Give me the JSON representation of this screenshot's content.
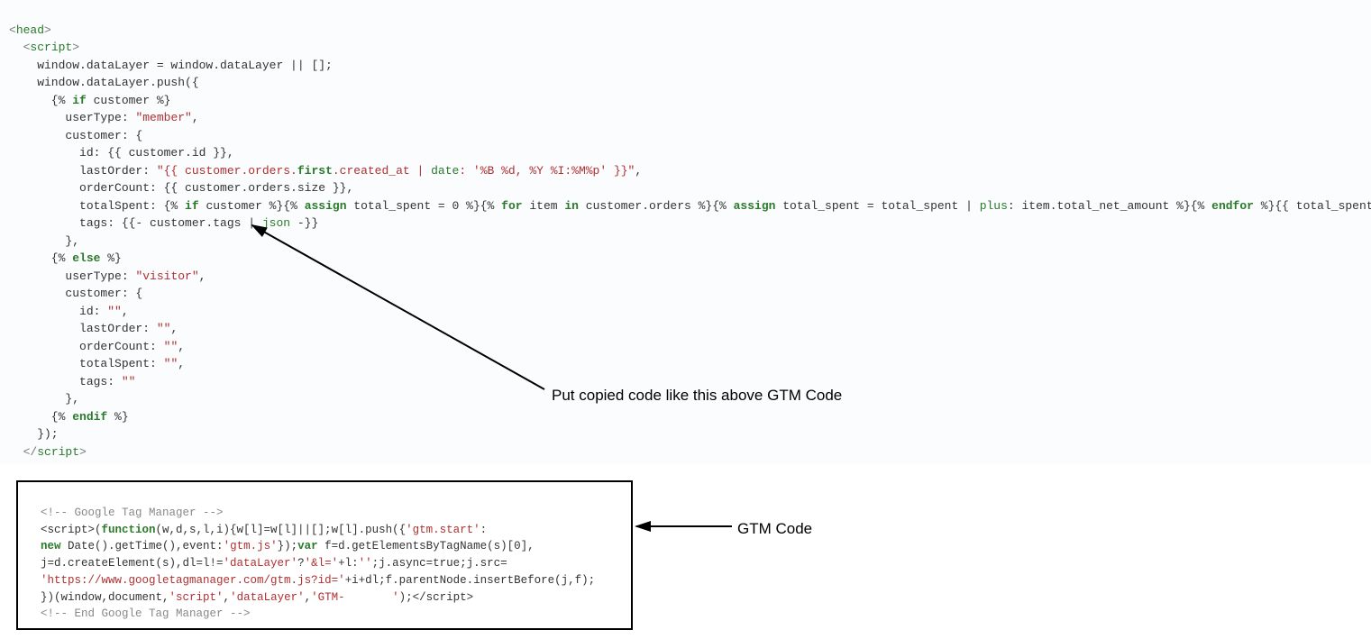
{
  "code": {
    "l1": "<head>",
    "l2": "  <script>",
    "l3a": "    window.dataLayer = window.dataLayer || [];",
    "l4a": "    window.dataLayer.push({",
    "l5a": "      {% ",
    "l5b": "if",
    "l5c": " customer %}",
    "l6a": "        userType: ",
    "l6b": "\"member\"",
    "l6c": ",",
    "l7a": "        customer: {",
    "l8a": "          id: {{ customer.id }},",
    "l9a": "          lastOrder: ",
    "l9b": "\"{{ customer.orders.",
    "l9c": "first",
    "l9d": ".created_at | ",
    "l9e": "date",
    "l9f": ": ",
    "l9g": "'%B %d, %Y %I:%M%p'",
    "l9h": " }}\"",
    "l9i": ",",
    "l10a": "          orderCount: {{ customer.orders.size }},",
    "l11a": "          totalSpent: {% ",
    "l11b": "if",
    "l11c": " customer %}{% ",
    "l11d": "assign",
    "l11e": " total_spent = ",
    "l11f": "0",
    "l11g": " %}{% ",
    "l11h": "for",
    "l11i": " item ",
    "l11j": "in",
    "l11k": " customer.orders %}{% ",
    "l11l": "assign",
    "l11m": " total_spent = total_spent | ",
    "l11n": "plus",
    "l11o": ": item.total_net_amount %}{% ",
    "l11p": "endfor",
    "l11q": " %}{{ total_spent",
    "l12a": "          tags: {{- customer.tags | ",
    "l12b": "json",
    "l12c": " -}}",
    "l13a": "        },",
    "l14a": "      {% ",
    "l14b": "else",
    "l14c": " %}",
    "l15a": "        userType: ",
    "l15b": "\"visitor\"",
    "l15c": ",",
    "l16a": "        customer: {",
    "l17a": "          id: ",
    "l17b": "\"\"",
    "l17c": ",",
    "l18a": "          lastOrder: ",
    "l18b": "\"\"",
    "l18c": ",",
    "l19a": "          orderCount: ",
    "l19b": "\"\"",
    "l19c": ",",
    "l20a": "          totalSpent: ",
    "l20b": "\"\"",
    "l20c": ",",
    "l21a": "          tags: ",
    "l21b": "\"\"",
    "l22a": "        },",
    "l23a": "      {% ",
    "l23b": "endif",
    "l23c": " %}",
    "l24a": "    });",
    "l25": "  </scr"
  },
  "gtm": {
    "c1": "  <!-- Google Tag Manager -->",
    "l2a": "  <script>(",
    "l2b": "function",
    "l2c": "(w,d,s,l,i){w[l]=w[l]||[];w[l].push({",
    "l2d": "'gtm.start'",
    "l2e": ":",
    "l3a": "  ",
    "l3b": "new",
    "l3c": " Date().getTime(),event:",
    "l3d": "'gtm.js'",
    "l3e": "});",
    "l3f": "var",
    "l3g": " f=d.getElementsByTagName(s)[",
    "l3h": "0",
    "l3i": "],",
    "l4a": "  j=d.createElement(s),dl=l!=",
    "l4b": "'dataLayer'",
    "l4c": "?",
    "l4d": "'&l='",
    "l4e": "+l:",
    "l4f": "''",
    "l4g": ";j.async=true;j.src=",
    "l5a": "  ",
    "l5b": "'https://www.googletagmanager.com/gtm.js?id='",
    "l5c": "+i+dl;f.parentNode.insertBefore(j,f);",
    "l6a": "  })(window,document,",
    "l6b": "'script'",
    "l6c": ",",
    "l6d": "'dataLayer'",
    "l6e": ",",
    "l6f": "'GTM-       '",
    "l6g": ");</scr",
    "c2": "  <!-- End Google Tag Manager -->"
  },
  "annotations": {
    "above": "Put copied code like this above GTM Code",
    "gtm": "GTM Code"
  }
}
